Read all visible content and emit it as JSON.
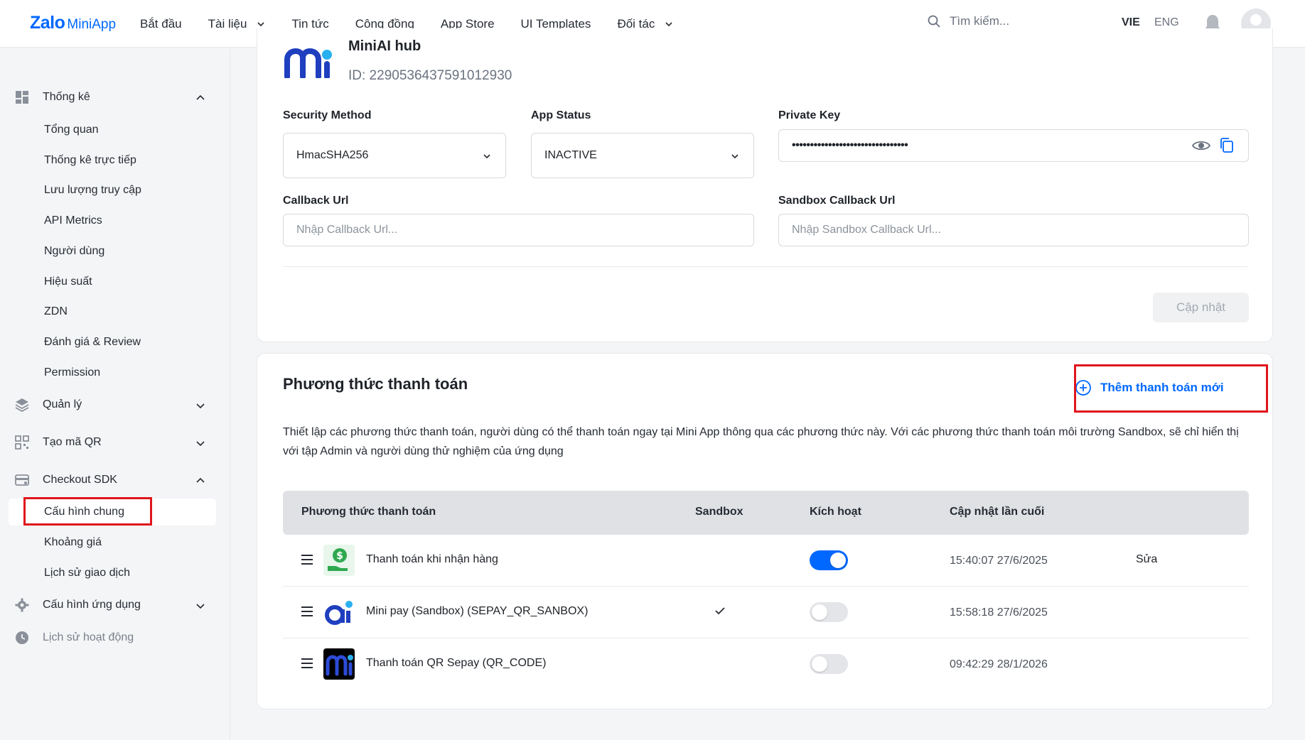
{
  "header": {
    "logo_main": "Zalo",
    "logo_sub": "MiniApp",
    "nav": [
      {
        "label": "Bắt đầu",
        "dropdown": false
      },
      {
        "label": "Tài liệu",
        "dropdown": true
      },
      {
        "label": "Tin tức",
        "dropdown": false
      },
      {
        "label": "Cộng đồng",
        "dropdown": false
      },
      {
        "label": "App Store",
        "dropdown": false
      },
      {
        "label": "UI Templates",
        "dropdown": false
      },
      {
        "label": "Đối tác",
        "dropdown": true
      }
    ],
    "search_placeholder": "Tìm kiếm...",
    "lang_active": "VIE",
    "lang_other": "ENG"
  },
  "sidebar": {
    "groups": {
      "thong_ke": "Thống kê",
      "quan_ly": "Quản lý",
      "tao_ma_qr": "Tạo mã QR",
      "checkout_sdk": "Checkout SDK",
      "cau_hinh_ung_dung": "Cấu hình ứng dụng",
      "lich_su_hoat_dong": "Lịch sử hoạt động"
    },
    "thong_ke_items": [
      "Tổng quan",
      "Thống kê trực tiếp",
      "Lưu lượng truy cập",
      "API Metrics",
      "Người dùng",
      "Hiệu suất",
      "ZDN",
      "Đánh giá & Review",
      "Permission"
    ],
    "checkout_items": [
      "Cấu hình chung",
      "Khoảng giá",
      "Lịch sử giao dịch"
    ],
    "active_item": "Cấu hình chung"
  },
  "app": {
    "name": "MiniAI hub",
    "id_text": "ID: 2290536437591012930"
  },
  "form": {
    "security_method_label": "Security Method",
    "security_method_value": "HmacSHA256",
    "app_status_label": "App Status",
    "app_status_value": "INACTIVE",
    "private_key_label": "Private Key",
    "private_key_value": "••••••••••••••••••••••••••••••••",
    "callback_label": "Callback Url",
    "callback_placeholder": "Nhập Callback Url...",
    "sandbox_callback_label": "Sandbox Callback Url",
    "sandbox_callback_placeholder": "Nhập Sandbox Callback Url...",
    "update_button": "Cập nhật"
  },
  "payment": {
    "title": "Phương thức thanh toán",
    "add_button": "Thêm thanh toán mới",
    "description": "Thiết lập các phương thức thanh toán, người dùng có thể thanh toán ngay tại Mini App thông qua các phương thức này. Với các phương thức thanh toán môi trường Sandbox, sẽ chỉ hiển thị với tập Admin và người dùng thử nghiệm của ứng dụng",
    "columns": [
      "Phương thức thanh toán",
      "Sandbox",
      "Kích hoạt",
      "Cập nhật lần cuối"
    ],
    "rows": [
      {
        "name": "Thanh toán khi nhận hàng",
        "sandbox": false,
        "active": true,
        "updated": "15:40:07 27/6/2025",
        "action": "Sửa",
        "icon": "cash-on-delivery-icon"
      },
      {
        "name": "Mini pay (Sandbox) (SEPAY_QR_SANBOX)",
        "sandbox": true,
        "active": false,
        "updated": "15:58:18 27/6/2025",
        "action": "",
        "icon": "mini-pay-icon"
      },
      {
        "name": "Thanh toán QR Sepay (QR_CODE)",
        "sandbox": false,
        "active": false,
        "updated": "09:42:29 28/1/2026",
        "action": "",
        "icon": "sepay-qr-icon"
      }
    ]
  },
  "colors": {
    "accent": "#0068ff",
    "highlight": "#e0151c"
  }
}
